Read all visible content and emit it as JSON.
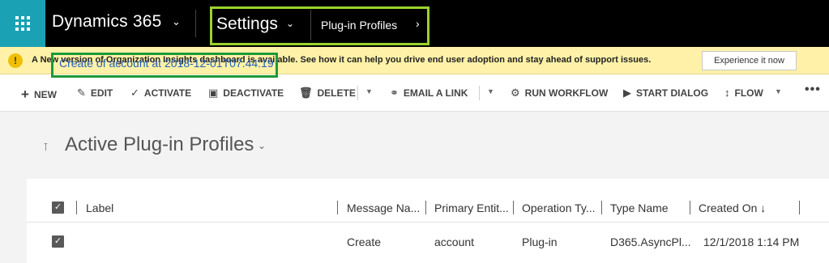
{
  "topbar": {
    "app_title": "Dynamics 365",
    "area_title": "Settings",
    "entity_link": "Plug-in Profiles"
  },
  "notice": {
    "icon": "!",
    "text": "A New version of Organization Insights dashboard is available. See how it can help you drive end user adoption and stay ahead of support issues.",
    "button": "Experience it now"
  },
  "commands": {
    "new": "NEW",
    "edit": "EDIT",
    "activate": "ACTIVATE",
    "deactivate": "DEACTIVATE",
    "delete": "DELETE",
    "email_link": "EMAIL A LINK",
    "run_workflow": "RUN WORKFLOW",
    "start_dialog": "START DIALOG",
    "flow": "FLOW",
    "more": "•••"
  },
  "view": {
    "title": "Active Plug-in Profiles"
  },
  "grid": {
    "columns": [
      "Label",
      "Message Na...",
      "Primary Entit...",
      "Operation Ty...",
      "Type Name",
      "Created On ↓"
    ],
    "rows": [
      [
        "Create of account at 2018-12-01T07:44:19",
        "Create",
        "account",
        "Plug-in",
        "D365.AsyncPl...",
        "12/1/2018 1:14 PM"
      ]
    ]
  },
  "colors": {
    "waffle_bg": "#1ba1b4",
    "highlight_green": "#9ad32c",
    "row_highlight": "#1d9a3a",
    "notice_bg": "#fff2a8",
    "link": "#2462b3"
  }
}
